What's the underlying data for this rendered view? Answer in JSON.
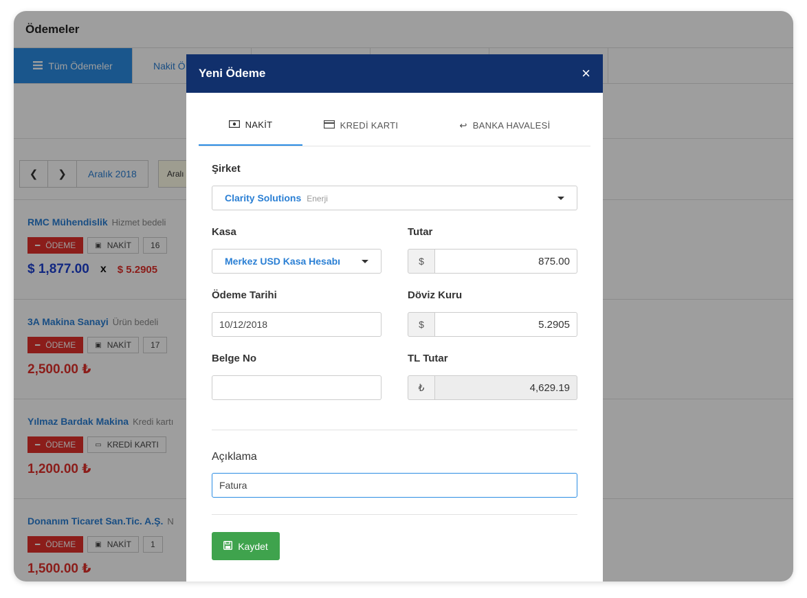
{
  "app": {
    "title": "Ödemeler"
  },
  "tabs": [
    {
      "label": "Tüm Ödemeler"
    },
    {
      "label": "Nakit Ö"
    }
  ],
  "nav": {
    "date_label": "Aralık 2018",
    "range_label": "Aralı"
  },
  "payments": [
    {
      "company": "RMC Mühendislik",
      "desc": "Hizmet bedeli",
      "type_chip": "ÖDEME",
      "method_chip": "NAKİT",
      "day": "16",
      "amount": "$ 1,877.00",
      "x": "x",
      "rate": "$ 5.2905"
    },
    {
      "company": "3A Makina Sanayi",
      "desc": "Ürün bedeli",
      "type_chip": "ÖDEME",
      "method_chip": "NAKİT",
      "day": "17",
      "amount": "2,500.00 ₺"
    },
    {
      "company": "Yılmaz Bardak Makina",
      "desc": "Kredi kartı",
      "type_chip": "ÖDEME",
      "method_chip": "KREDİ KARTI",
      "amount": "1,200.00 ₺"
    },
    {
      "company": "Donanım Ticaret San.Tic. A.Ş.",
      "desc": "N",
      "type_chip": "ÖDEME",
      "method_chip": "NAKİT",
      "day": "1",
      "amount": "1,500.00 ₺"
    }
  ],
  "modal": {
    "title": "Yeni Ödeme",
    "close": "×",
    "tabs": [
      "NAKİT",
      "KREDİ KARTI",
      "BANKA HAVALESİ"
    ],
    "fields": {
      "sirket_label": "Şirket",
      "sirket_value": "Clarity Solutions",
      "sirket_sub": "Enerji",
      "kasa_label": "Kasa",
      "kasa_value": "Merkez USD Kasa Hesabı",
      "tutar_label": "Tutar",
      "tutar_addon": "$",
      "tutar_value": "875.00",
      "tarih_label": "Ödeme Tarihi",
      "tarih_value": "10/12/2018",
      "kur_label": "Döviz Kuru",
      "kur_addon": "$",
      "kur_value": "5.2905",
      "belge_label": "Belge No",
      "belge_value": "",
      "tl_label": "TL Tutar",
      "tl_addon": "₺",
      "tl_value": "4,629.19",
      "aciklama_label": "Açıklama",
      "aciklama_value": "Fatura"
    },
    "save_label": "Kaydet"
  },
  "colors": {
    "header": "#11306c",
    "accent": "#2a8ce3",
    "danger": "#e0302a",
    "success": "#3fa34d"
  }
}
